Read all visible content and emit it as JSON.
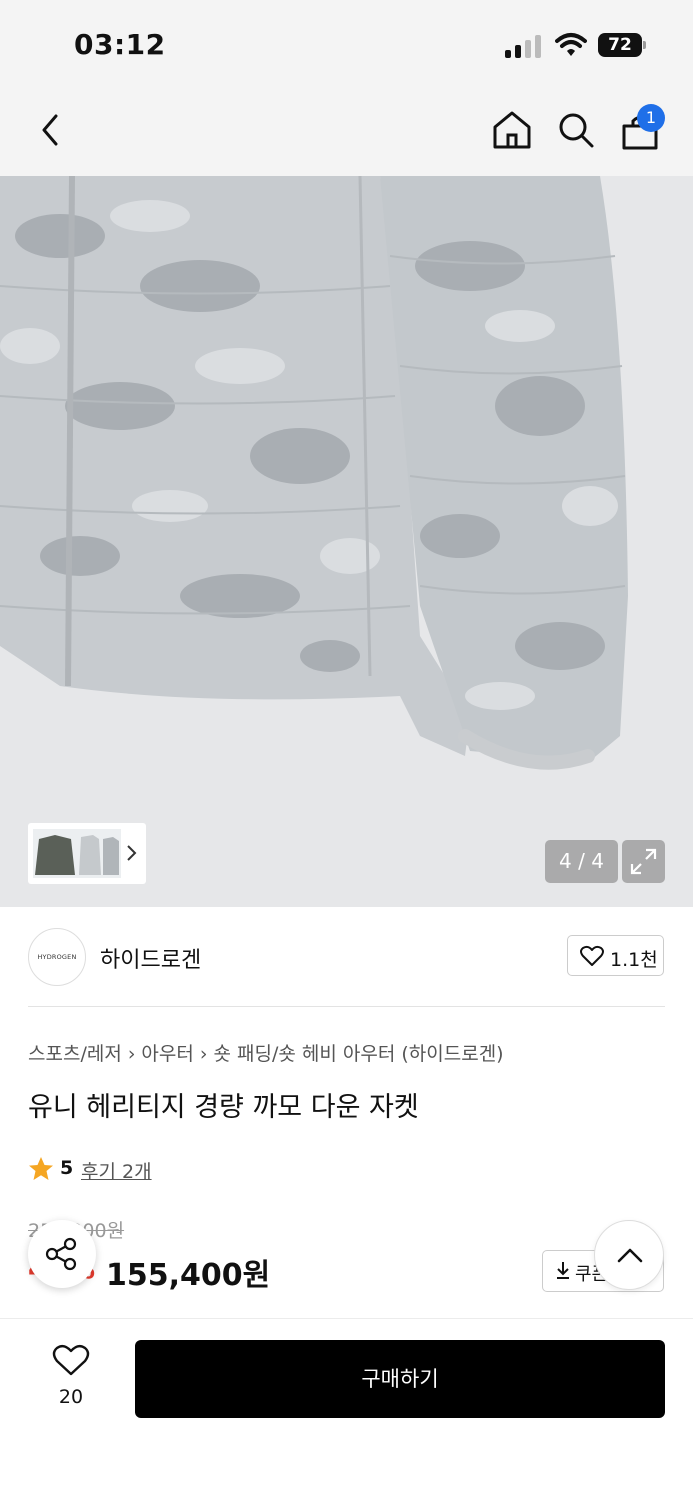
{
  "status_bar": {
    "time": "03:12",
    "battery": "72"
  },
  "nav": {
    "cart_count": "1"
  },
  "gallery": {
    "counter": "4 / 4"
  },
  "brand": {
    "logo_text": "HYDROGEN",
    "name": "하이드로겐",
    "like_count": "1.1천"
  },
  "breadcrumb": [
    "스포츠/레저",
    "아우터",
    "숏 패딩/숏 헤비 아우터 (하이드로겐)"
  ],
  "product": {
    "title": "유니 헤리티지 경량 까모 다운 자켓",
    "rating": "5",
    "review_link": "후기 2개",
    "original_price": "259,000원",
    "discount": "40%",
    "sale_price": "155,400원",
    "coupon_label": "쿠폰"
  },
  "bottom": {
    "wish_count": "20",
    "buy_label": "구매하기"
  },
  "colors": {
    "accent": "#1f6fe8",
    "star": "#f5a623",
    "discount": "#e63b2e",
    "buy_bg": "#000000"
  }
}
